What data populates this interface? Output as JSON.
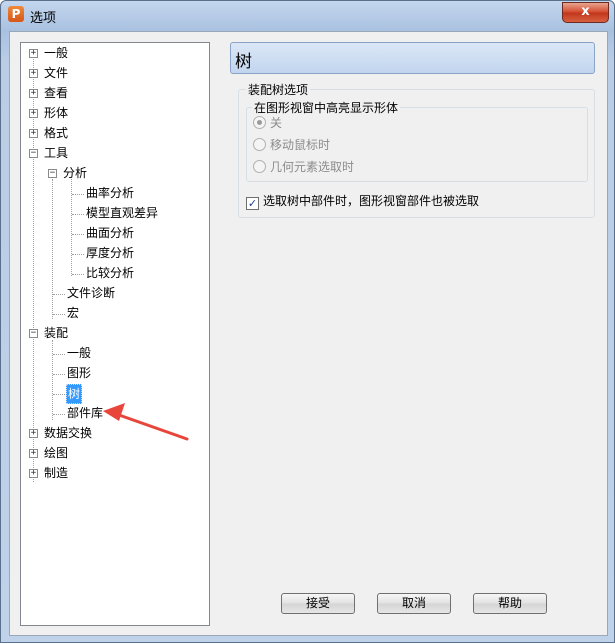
{
  "window": {
    "title": "选项",
    "app_icon": "P",
    "close_glyph": "x"
  },
  "tree": {
    "items": [
      {
        "label": "一般"
      },
      {
        "label": "文件"
      },
      {
        "label": "查看"
      },
      {
        "label": "形体"
      },
      {
        "label": "格式"
      },
      {
        "label": "工具"
      },
      {
        "label": "分析"
      },
      {
        "label": "曲率分析"
      },
      {
        "label": "模型直观差异"
      },
      {
        "label": "曲面分析"
      },
      {
        "label": "厚度分析"
      },
      {
        "label": "比较分析"
      },
      {
        "label": "文件诊断"
      },
      {
        "label": "宏"
      },
      {
        "label": "装配"
      },
      {
        "label": "一般"
      },
      {
        "label": "图形"
      },
      {
        "label": "树"
      },
      {
        "label": "部件库"
      },
      {
        "label": "数据交换"
      },
      {
        "label": "绘图"
      },
      {
        "label": "制造"
      }
    ],
    "selected": "树"
  },
  "panel": {
    "title": "树",
    "group_title": "装配树选项",
    "subgroup_title": "在图形视窗中高亮显示形体",
    "radios": [
      {
        "label": "关",
        "checked": true
      },
      {
        "label": "移动鼠标时",
        "checked": false
      },
      {
        "label": "几何元素选取时",
        "checked": false
      }
    ],
    "checkbox": {
      "label": "选取树中部件时，图形视窗部件也被选取",
      "checked": true
    }
  },
  "buttons": {
    "ok": "接受",
    "cancel": "取消",
    "help": "帮助"
  },
  "annotation": {
    "arrow_color": "#e8463b"
  }
}
